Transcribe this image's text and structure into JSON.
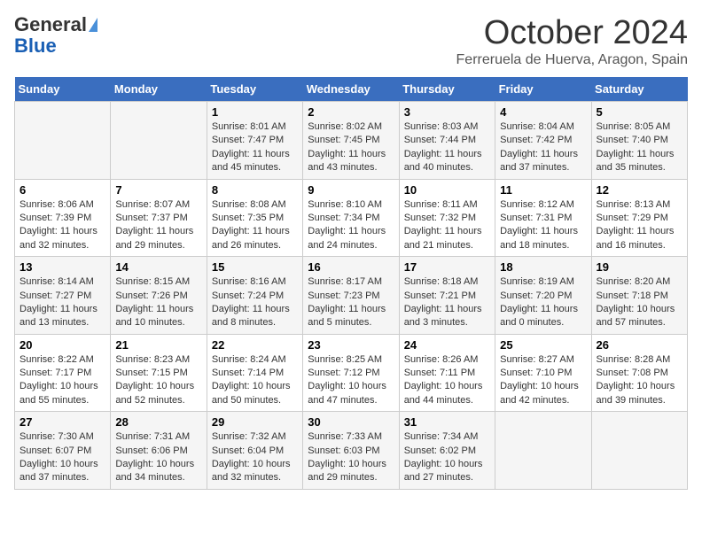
{
  "header": {
    "logo_line1": "General",
    "logo_line2": "Blue",
    "month": "October 2024",
    "location": "Ferreruela de Huerva, Aragon, Spain"
  },
  "weekdays": [
    "Sunday",
    "Monday",
    "Tuesday",
    "Wednesday",
    "Thursday",
    "Friday",
    "Saturday"
  ],
  "weeks": [
    [
      {
        "day": "",
        "info": ""
      },
      {
        "day": "",
        "info": ""
      },
      {
        "day": "1",
        "info": "Sunrise: 8:01 AM\nSunset: 7:47 PM\nDaylight: 11 hours and 45 minutes."
      },
      {
        "day": "2",
        "info": "Sunrise: 8:02 AM\nSunset: 7:45 PM\nDaylight: 11 hours and 43 minutes."
      },
      {
        "day": "3",
        "info": "Sunrise: 8:03 AM\nSunset: 7:44 PM\nDaylight: 11 hours and 40 minutes."
      },
      {
        "day": "4",
        "info": "Sunrise: 8:04 AM\nSunset: 7:42 PM\nDaylight: 11 hours and 37 minutes."
      },
      {
        "day": "5",
        "info": "Sunrise: 8:05 AM\nSunset: 7:40 PM\nDaylight: 11 hours and 35 minutes."
      }
    ],
    [
      {
        "day": "6",
        "info": "Sunrise: 8:06 AM\nSunset: 7:39 PM\nDaylight: 11 hours and 32 minutes."
      },
      {
        "day": "7",
        "info": "Sunrise: 8:07 AM\nSunset: 7:37 PM\nDaylight: 11 hours and 29 minutes."
      },
      {
        "day": "8",
        "info": "Sunrise: 8:08 AM\nSunset: 7:35 PM\nDaylight: 11 hours and 26 minutes."
      },
      {
        "day": "9",
        "info": "Sunrise: 8:10 AM\nSunset: 7:34 PM\nDaylight: 11 hours and 24 minutes."
      },
      {
        "day": "10",
        "info": "Sunrise: 8:11 AM\nSunset: 7:32 PM\nDaylight: 11 hours and 21 minutes."
      },
      {
        "day": "11",
        "info": "Sunrise: 8:12 AM\nSunset: 7:31 PM\nDaylight: 11 hours and 18 minutes."
      },
      {
        "day": "12",
        "info": "Sunrise: 8:13 AM\nSunset: 7:29 PM\nDaylight: 11 hours and 16 minutes."
      }
    ],
    [
      {
        "day": "13",
        "info": "Sunrise: 8:14 AM\nSunset: 7:27 PM\nDaylight: 11 hours and 13 minutes."
      },
      {
        "day": "14",
        "info": "Sunrise: 8:15 AM\nSunset: 7:26 PM\nDaylight: 11 hours and 10 minutes."
      },
      {
        "day": "15",
        "info": "Sunrise: 8:16 AM\nSunset: 7:24 PM\nDaylight: 11 hours and 8 minutes."
      },
      {
        "day": "16",
        "info": "Sunrise: 8:17 AM\nSunset: 7:23 PM\nDaylight: 11 hours and 5 minutes."
      },
      {
        "day": "17",
        "info": "Sunrise: 8:18 AM\nSunset: 7:21 PM\nDaylight: 11 hours and 3 minutes."
      },
      {
        "day": "18",
        "info": "Sunrise: 8:19 AM\nSunset: 7:20 PM\nDaylight: 11 hours and 0 minutes."
      },
      {
        "day": "19",
        "info": "Sunrise: 8:20 AM\nSunset: 7:18 PM\nDaylight: 10 hours and 57 minutes."
      }
    ],
    [
      {
        "day": "20",
        "info": "Sunrise: 8:22 AM\nSunset: 7:17 PM\nDaylight: 10 hours and 55 minutes."
      },
      {
        "day": "21",
        "info": "Sunrise: 8:23 AM\nSunset: 7:15 PM\nDaylight: 10 hours and 52 minutes."
      },
      {
        "day": "22",
        "info": "Sunrise: 8:24 AM\nSunset: 7:14 PM\nDaylight: 10 hours and 50 minutes."
      },
      {
        "day": "23",
        "info": "Sunrise: 8:25 AM\nSunset: 7:12 PM\nDaylight: 10 hours and 47 minutes."
      },
      {
        "day": "24",
        "info": "Sunrise: 8:26 AM\nSunset: 7:11 PM\nDaylight: 10 hours and 44 minutes."
      },
      {
        "day": "25",
        "info": "Sunrise: 8:27 AM\nSunset: 7:10 PM\nDaylight: 10 hours and 42 minutes."
      },
      {
        "day": "26",
        "info": "Sunrise: 8:28 AM\nSunset: 7:08 PM\nDaylight: 10 hours and 39 minutes."
      }
    ],
    [
      {
        "day": "27",
        "info": "Sunrise: 7:30 AM\nSunset: 6:07 PM\nDaylight: 10 hours and 37 minutes."
      },
      {
        "day": "28",
        "info": "Sunrise: 7:31 AM\nSunset: 6:06 PM\nDaylight: 10 hours and 34 minutes."
      },
      {
        "day": "29",
        "info": "Sunrise: 7:32 AM\nSunset: 6:04 PM\nDaylight: 10 hours and 32 minutes."
      },
      {
        "day": "30",
        "info": "Sunrise: 7:33 AM\nSunset: 6:03 PM\nDaylight: 10 hours and 29 minutes."
      },
      {
        "day": "31",
        "info": "Sunrise: 7:34 AM\nSunset: 6:02 PM\nDaylight: 10 hours and 27 minutes."
      },
      {
        "day": "",
        "info": ""
      },
      {
        "day": "",
        "info": ""
      }
    ]
  ]
}
